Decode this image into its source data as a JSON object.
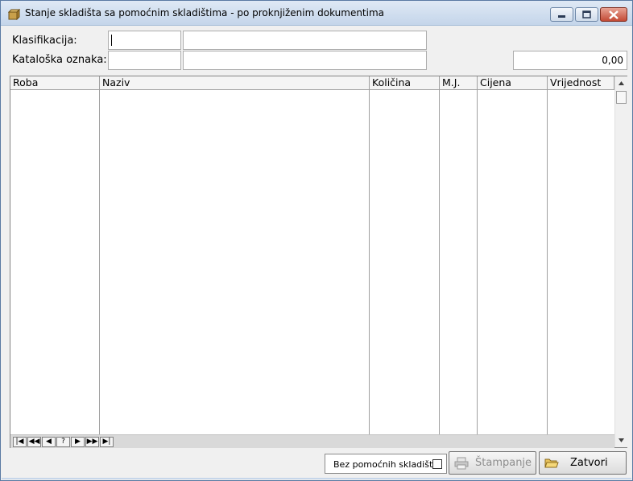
{
  "window": {
    "title": "Stanje skladišta sa pomoćnim skladištima - po proknjiženim dokumentima"
  },
  "icons": {
    "app": "box-icon",
    "minimize": "minimize-icon",
    "maximize": "maximize-icon",
    "close": "close-icon",
    "print": "printer-icon",
    "close_form": "open-folder-icon"
  },
  "filters": {
    "klasifikacija_label": "Klasifikacija:",
    "klasifikacija_code": "",
    "klasifikacija_name": "",
    "kataloska_label": "Kataloška oznaka:",
    "kataloska_code": "",
    "kataloska_name": "",
    "total_value": "0,00"
  },
  "grid": {
    "columns": [
      "Roba",
      "Naziv",
      "Količina",
      "M.J.",
      "Cijena",
      "Vrijednost"
    ],
    "rows": []
  },
  "navigator": {
    "buttons": [
      "|◀",
      "◀◀",
      "◀",
      "?",
      "▶",
      "▶▶",
      "▶|"
    ]
  },
  "footer": {
    "checkbox_label": "Bez pomoćnih skladišta",
    "checkbox_checked": false,
    "print_label": "Štampanje",
    "print_enabled": false,
    "close_label": "Zatvori"
  },
  "colors": {
    "title_bar": "#c4d5ea",
    "close_button": "#c34a35",
    "window_bg": "#f0f0f0"
  }
}
